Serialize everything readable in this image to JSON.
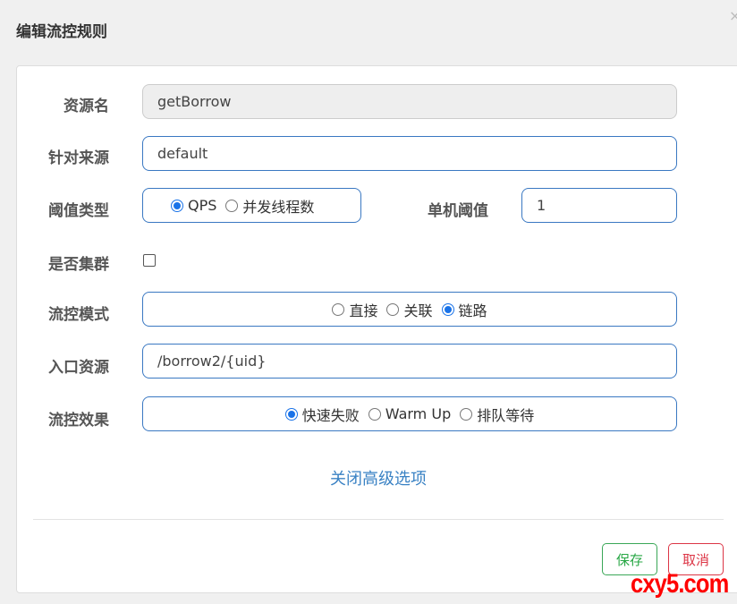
{
  "dialog": {
    "title": "编辑流控规则",
    "close": "×"
  },
  "form": {
    "resource": {
      "label": "资源名",
      "value": "getBorrow"
    },
    "limit_app": {
      "label": "针对来源",
      "value": "default"
    },
    "grade": {
      "label": "阈值类型",
      "options": [
        "QPS",
        "并发线程数"
      ],
      "selected": "QPS"
    },
    "count": {
      "label": "单机阈值",
      "value": "1"
    },
    "cluster": {
      "label": "是否集群",
      "checked": false
    },
    "strategy": {
      "label": "流控模式",
      "options": [
        "直接",
        "关联",
        "链路"
      ],
      "selected": "链路"
    },
    "ref_resource": {
      "label": "入口资源",
      "value": "/borrow2/{uid}"
    },
    "control_behavior": {
      "label": "流控效果",
      "options": [
        "快速失败",
        "Warm Up",
        "排队等待"
      ],
      "selected": "快速失败"
    },
    "advanced_link": "关闭高级选项"
  },
  "footer": {
    "save": "保存",
    "cancel": "取消"
  },
  "watermark": "cxy5.com",
  "colors": {
    "accent": "#3a78c2",
    "save": "#28a745",
    "cancel": "#dc3545"
  }
}
